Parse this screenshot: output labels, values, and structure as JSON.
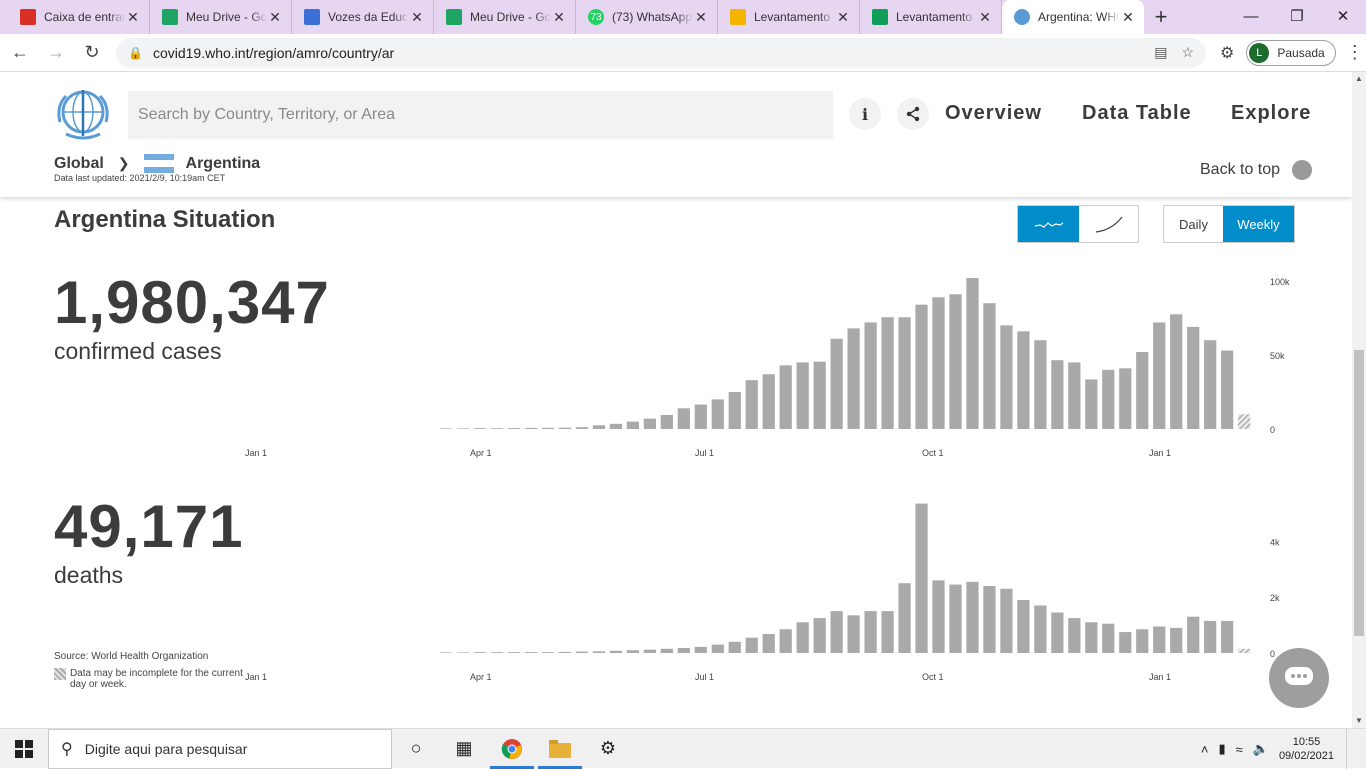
{
  "browser": {
    "tabs": [
      {
        "title": "Caixa de entrada",
        "icon": "gmail-icon",
        "color": "#d93025"
      },
      {
        "title": "Meu Drive - Google",
        "icon": "google-drive-icon",
        "color": "#1fa463"
      },
      {
        "title": "Vozes da Educação",
        "icon": "google-forms-icon",
        "color": "#3b6fd4"
      },
      {
        "title": "Meu Drive - Google",
        "icon": "google-drive-icon",
        "color": "#1fa463"
      },
      {
        "title": "(73) WhatsApp",
        "icon": "whatsapp-icon",
        "color": "#25d366"
      },
      {
        "title": "Levantamento",
        "icon": "google-slides-icon",
        "color": "#f4b400"
      },
      {
        "title": "Levantamento",
        "icon": "google-sheets-icon",
        "color": "#0f9d58"
      },
      {
        "title": "Argentina: WHO",
        "icon": "who-icon",
        "color": "#5b9bd5"
      }
    ],
    "whatsapp_badge": "73",
    "url": "covid19.who.int/region/amro/country/ar",
    "profile_initial": "L",
    "profile_label": "Pausada"
  },
  "header": {
    "search_placeholder": "Search by Country, Territory, or Area",
    "nav": [
      "Overview",
      "Data Table",
      "Explore"
    ],
    "breadcrumb_global": "Global",
    "breadcrumb_country": "Argentina",
    "updated": "Data last updated: 2021/2/9, 10:19am CET",
    "back_to_top": "Back to top"
  },
  "situation": {
    "title": "Argentina Situation",
    "daily": "Daily",
    "weekly": "Weekly",
    "cases_number": "1,980,347",
    "cases_label": "confirmed cases",
    "deaths_number": "49,171",
    "deaths_label": "deaths",
    "source": "Source:  World Health Organization",
    "incomplete_note": "Data may be incomplete for the current day or week."
  },
  "colors": {
    "accent": "#008dc9",
    "bar": "#a9a9a9"
  },
  "chart_data": [
    {
      "type": "bar",
      "title": "",
      "xlabel": "",
      "ylabel": "",
      "x_ticks": [
        "Jan 1",
        "Apr 1",
        "Jul 1",
        "Oct 1",
        "Jan 1"
      ],
      "y_ticks": [
        "0",
        "50k",
        "100k"
      ],
      "ylim": [
        0,
        100000
      ],
      "series": [
        {
          "values": [
            0,
            0,
            300,
            500,
            600,
            700,
            800,
            900,
            1200,
            2500,
            3500,
            5000,
            7000,
            9500,
            14000,
            16500,
            20000,
            25000,
            33000,
            37000,
            43000,
            45000,
            45500,
            61000,
            68000,
            72000,
            75500,
            75500,
            84000,
            89000,
            91000,
            102000,
            85000,
            70000,
            66000,
            60000,
            46500,
            45000,
            33500,
            40000,
            41000,
            52000,
            72000,
            77500,
            69000,
            60000,
            53000,
            10000
          ]
        }
      ]
    },
    {
      "type": "bar",
      "title": "",
      "xlabel": "",
      "ylabel": "",
      "x_ticks": [
        "Jan 1",
        "Apr 1",
        "Jul 1",
        "Oct 1",
        "Jan 1"
      ],
      "y_ticks": [
        "0",
        "2k",
        "4k"
      ],
      "ylim": [
        0,
        5300
      ],
      "series": [
        {
          "values": [
            0,
            0,
            20,
            30,
            30,
            30,
            30,
            40,
            50,
            60,
            80,
            100,
            120,
            150,
            180,
            220,
            300,
            400,
            550,
            680,
            850,
            1100,
            1250,
            1500,
            1350,
            1500,
            1500,
            2500,
            5350,
            2600,
            2450,
            2550,
            2400,
            2300,
            1900,
            1700,
            1450,
            1250,
            1100,
            1050,
            750,
            850,
            950,
            900,
            1300,
            1150,
            1150,
            150
          ]
        }
      ]
    }
  ],
  "taskbar": {
    "search_placeholder": "Digite aqui para pesquisar",
    "time": "10:55",
    "date": "09/02/2021"
  }
}
